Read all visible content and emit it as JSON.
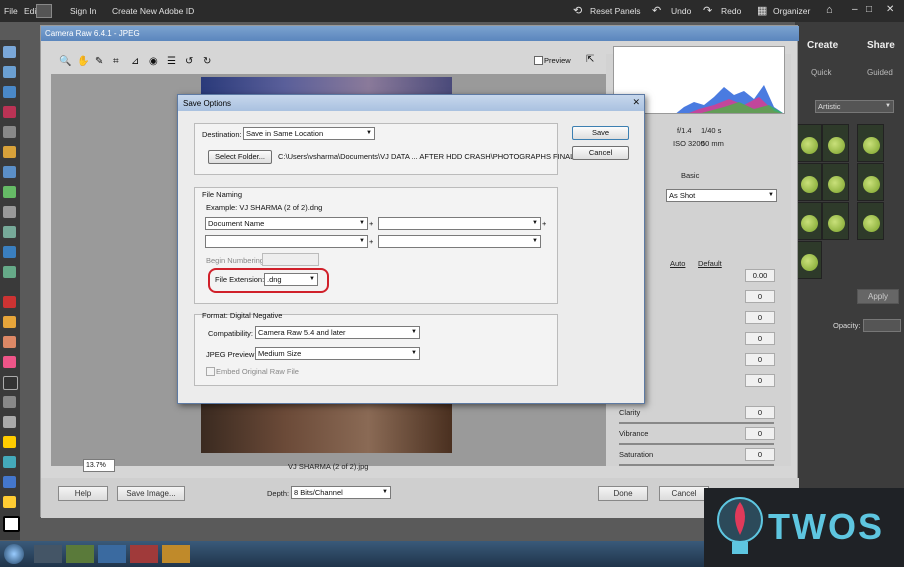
{
  "topbar": {
    "file": "File",
    "edit": "Edit",
    "sign_in": "Sign In",
    "create_adobe_id": "Create New Adobe ID",
    "reset_panels": "Reset Panels",
    "undo": "Undo",
    "redo": "Redo",
    "organizer": "Organizer"
  },
  "right_panel": {
    "create": "Create",
    "share": "Share",
    "quick": "Quick",
    "guided": "Guided",
    "style": "Artistic",
    "apply": "Apply",
    "opacity": "Opacity:"
  },
  "camera_raw": {
    "title": "Camera Raw 6.4.1 - JPEG",
    "preview": "Preview",
    "aperture": "f/1.4",
    "shutter": "1/40 s",
    "iso": "ISO 3200",
    "lens": "50 mm",
    "basic_tab": "Basic",
    "white_balance": "As Shot",
    "auto": "Auto",
    "default": "Default",
    "exposure_value": "0.00",
    "values": [
      "0",
      "0",
      "0",
      "0",
      "0",
      "0",
      "0"
    ],
    "clarity": "Clarity",
    "vibrance": "Vibrance",
    "saturation": "Saturation",
    "zoom": "13.7%",
    "filename": "VJ SHARMA (2 of 2).jpg",
    "help": "Help",
    "save_image": "Save Image...",
    "depth_label": "Depth:",
    "depth_value": "8 Bits/Channel",
    "done": "Done",
    "cancel": "Cancel"
  },
  "dialog": {
    "title": "Save Options",
    "destination_label": "Destination:",
    "destination_value": "Save in Same Location",
    "select_folder": "Select Folder...",
    "path": "C:\\Users\\vsharma\\Documents\\VJ DATA ... AFTER HDD CRASH\\PHOTOGRAPHS FINAL\\",
    "save": "Save",
    "cancel": "Cancel",
    "file_naming": "File Naming",
    "example": "Example:  VJ SHARMA (2 of 2).dng",
    "name_field1": "Document Name",
    "plus": "+",
    "begin_numbering": "Begin Numbering:",
    "file_extension_label": "File Extension:",
    "file_extension_value": ".dng",
    "format_label": "Format:  Digital Negative",
    "compatibility_label": "Compatibility:",
    "compatibility_value": "Camera Raw 5.4 and later",
    "jpeg_preview_label": "JPEG Preview:",
    "jpeg_preview_value": "Medium Size",
    "embed_original": "Embed Original Raw File"
  },
  "watermark": {
    "text": "TWOS"
  },
  "colors": {
    "highlight": "#d0202a",
    "accent": "#5b86bd"
  }
}
